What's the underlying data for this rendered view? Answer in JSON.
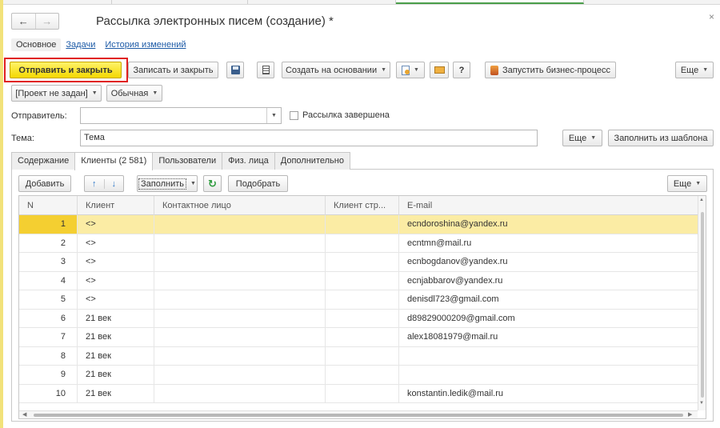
{
  "window": {
    "title": "Рассылка электронных писем (создание) *",
    "back_glyph": "←",
    "forward_glyph": "→",
    "close_glyph": "×"
  },
  "nav": {
    "links": [
      {
        "label": "Основное",
        "current": true
      },
      {
        "label": "Задачи",
        "current": false
      },
      {
        "label": "История изменений",
        "current": false
      }
    ]
  },
  "toolbar": {
    "send_close": "Отправить и закрыть",
    "save_close": "Записать и закрыть",
    "create_based": "Создать на основании",
    "help": "?",
    "start_bp": "Запустить бизнес-процесс",
    "more": "Еще"
  },
  "toolbar2": {
    "project": "[Проект не задан]",
    "importance": "Обычная"
  },
  "form": {
    "sender_label": "Отправитель:",
    "sender_value": "",
    "completed_label": "Рассылка завершена",
    "subject_label": "Тема:",
    "subject_value": "Тема",
    "more": "Еще",
    "fill_template": "Заполнить из шаблона"
  },
  "tabs": [
    {
      "label": "Содержание",
      "active": false
    },
    {
      "label": "Клиенты (2 581)",
      "active": true
    },
    {
      "label": "Пользователи",
      "active": false
    },
    {
      "label": "Физ. лица",
      "active": false
    },
    {
      "label": "Дополнительно",
      "active": false
    }
  ],
  "grid_toolbar": {
    "add": "Добавить",
    "up_glyph": "↑",
    "down_glyph": "↓",
    "fill": "Заполнить",
    "refresh_glyph": "↻",
    "select": "Подобрать",
    "more": "Еще"
  },
  "table": {
    "columns": [
      "N",
      "Клиент",
      "Контактное лицо",
      "Клиент стр...",
      "E-mail"
    ],
    "rows": [
      {
        "n": "1",
        "client": "<>",
        "contact": "",
        "client_str": "",
        "email": "ecndoroshina@yandex.ru",
        "selected": true
      },
      {
        "n": "2",
        "client": "<>",
        "contact": "",
        "client_str": "",
        "email": "ecntmn@mail.ru"
      },
      {
        "n": "3",
        "client": "<>",
        "contact": "",
        "client_str": "",
        "email": "ecnbogdanov@yandex.ru"
      },
      {
        "n": "4",
        "client": "<>",
        "contact": "",
        "client_str": "",
        "email": "ecnjabbarov@yandex.ru"
      },
      {
        "n": "5",
        "client": "<>",
        "contact": "",
        "client_str": "",
        "email": "denisdl723@gmail.com"
      },
      {
        "n": "6",
        "client": "21 век",
        "contact": "",
        "client_str": "",
        "email": "d89829000209@gmail.com"
      },
      {
        "n": "7",
        "client": "21 век",
        "contact": "",
        "client_str": "",
        "email": "alex18081979@mail.ru"
      },
      {
        "n": "8",
        "client": "21 век",
        "contact": "",
        "client_str": "",
        "email": ""
      },
      {
        "n": "9",
        "client": "21 век",
        "contact": "",
        "client_str": "",
        "email": ""
      },
      {
        "n": "10",
        "client": "21 век",
        "contact": "",
        "client_str": "",
        "email": "konstantin.ledik@mail.ru"
      }
    ]
  },
  "colors": {
    "primary_button": "#f4d800",
    "selected_row": "#fbeca4",
    "selected_cell": "#f4cf31",
    "highlight_border": "#e02020",
    "link": "#1c5aa6"
  }
}
